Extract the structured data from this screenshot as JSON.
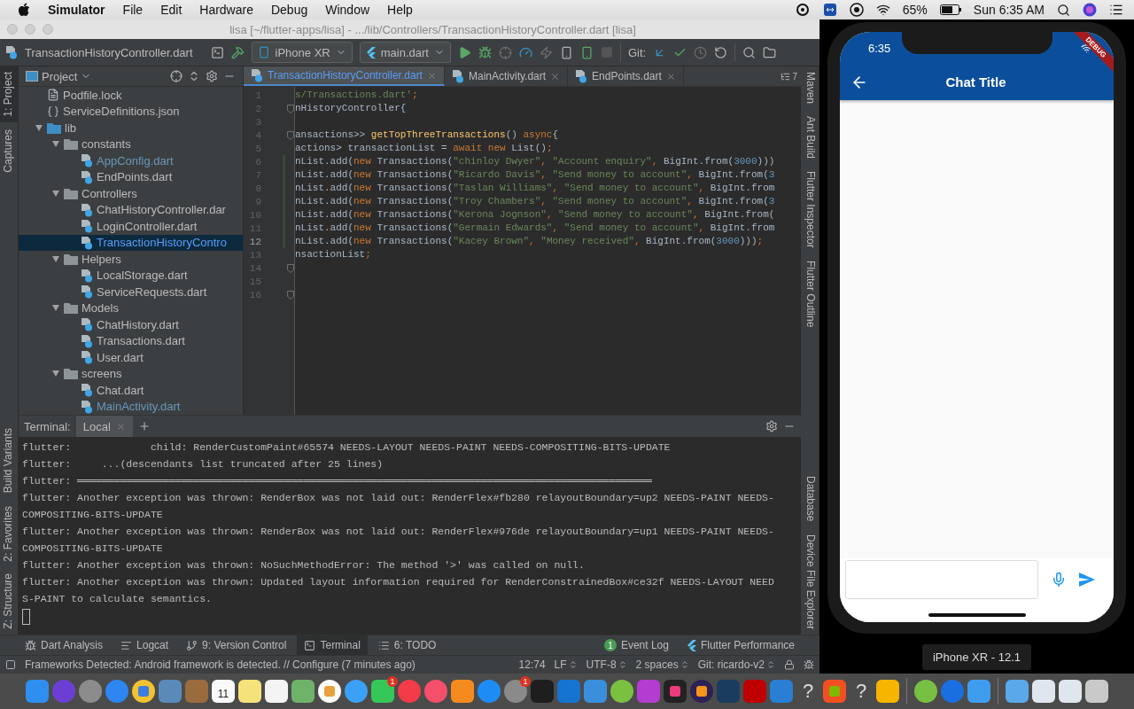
{
  "menu_bar": {
    "app": "Simulator",
    "menus": [
      "File",
      "Edit",
      "Hardware",
      "Debug",
      "Window",
      "Help"
    ],
    "battery": "65%",
    "clock": "Sun 6:35 AM"
  },
  "ide": {
    "title": "lisa [~/flutter-apps/lisa] - .../lib/Controllers/TransactionHistoryController.dart [lisa]",
    "toolbar": {
      "breadcrumb": "TransactionHistoryController.dart",
      "device": "iPhone XR",
      "run_config": "main.dart",
      "git_label": "Git:"
    },
    "left_tools_top": [
      {
        "label": "1: Project",
        "selected": true
      },
      {
        "label": "Captures",
        "selected": false
      }
    ],
    "left_tools_bottom": [
      {
        "label": "Build Variants",
        "selected": false
      },
      {
        "label": "2: Favorites",
        "selected": false
      },
      {
        "label": "Z: Structure",
        "selected": false
      }
    ],
    "right_tools_top": [
      {
        "label": "Maven",
        "selected": false
      },
      {
        "label": "Ant Build",
        "selected": false
      },
      {
        "label": "Flutter Inspector",
        "selected": false
      },
      {
        "label": "Flutter Outline",
        "selected": false
      }
    ],
    "right_tools_bottom": [
      {
        "label": "Database",
        "selected": false
      },
      {
        "label": "Device File Explorer",
        "selected": false
      }
    ],
    "project_panel": {
      "title": "Project",
      "tree": [
        {
          "name": "Podfile.lock",
          "kind": "text",
          "modified": false,
          "selected": false
        },
        {
          "name": "ServiceDefinitions.json",
          "kind": "json",
          "modified": false,
          "selected": false
        },
        {
          "name": "lib",
          "kind": "source",
          "expanded": true,
          "modified": false,
          "selected": false,
          "children": [
            {
              "name": "constants",
              "kind": "folder",
              "expanded": true,
              "modified": false,
              "selected": false,
              "children": [
                {
                  "name": "AppConfig.dart",
                  "kind": "dart",
                  "modified": true,
                  "selected": false
                },
                {
                  "name": "EndPoints.dart",
                  "kind": "dart",
                  "modified": false,
                  "selected": false
                }
              ]
            },
            {
              "name": "Controllers",
              "kind": "folder",
              "expanded": true,
              "modified": false,
              "selected": false,
              "children": [
                {
                  "name": "ChatHistoryController.dar",
                  "kind": "dart",
                  "modified": false,
                  "selected": false
                },
                {
                  "name": "LoginController.dart",
                  "kind": "dart",
                  "modified": false,
                  "selected": false
                },
                {
                  "name": "TransactionHistoryContro",
                  "kind": "dart",
                  "modified": true,
                  "selected": true
                }
              ]
            },
            {
              "name": "Helpers",
              "kind": "folder",
              "expanded": true,
              "modified": false,
              "selected": false,
              "children": [
                {
                  "name": "LocalStorage.dart",
                  "kind": "dart",
                  "modified": false,
                  "selected": false
                },
                {
                  "name": "ServiceRequests.dart",
                  "kind": "dart",
                  "modified": false,
                  "selected": false
                }
              ]
            },
            {
              "name": "Models",
              "kind": "folder",
              "expanded": true,
              "modified": false,
              "selected": false,
              "children": [
                {
                  "name": "ChatHistory.dart",
                  "kind": "dart",
                  "modified": false,
                  "selected": false
                },
                {
                  "name": "Transactions.dart",
                  "kind": "dart",
                  "modified": false,
                  "selected": false
                },
                {
                  "name": "User.dart",
                  "kind": "dart",
                  "modified": false,
                  "selected": false
                }
              ]
            },
            {
              "name": "screens",
              "kind": "folder",
              "expanded": true,
              "modified": false,
              "selected": false,
              "children": [
                {
                  "name": "Chat.dart",
                  "kind": "dart",
                  "modified": false,
                  "selected": false
                },
                {
                  "name": "MainActivity.dart",
                  "kind": "dart",
                  "modified": true,
                  "selected": false
                }
              ]
            }
          ]
        }
      ]
    },
    "editor": {
      "tabs": [
        {
          "label": "TransactionHistoryController.dart",
          "selected": true
        },
        {
          "label": "MainActivity.dart",
          "selected": false
        },
        {
          "label": "EndPoints.dart",
          "selected": false
        }
      ],
      "hidden_tab_count": "7",
      "lines": [
        {
          "number": "1",
          "current": false,
          "changed": false,
          "fold": false,
          "tokens": [
            {
              "kind": "string",
              "text": "s/Transactions.dart'"
            },
            {
              "kind": "keyword",
              "text": ";"
            }
          ]
        },
        {
          "number": "2",
          "current": false,
          "changed": false,
          "fold": true,
          "tokens": [
            {
              "kind": "plain",
              "text": "nHistoryController{"
            }
          ]
        },
        {
          "number": "3",
          "current": false,
          "changed": false,
          "fold": false
        },
        {
          "number": "4",
          "current": false,
          "changed": false,
          "fold": true,
          "tokens": [
            {
              "kind": "plain",
              "text": "ansactions>> "
            },
            {
              "kind": "method",
              "text": "getTopThreeTransactions"
            },
            {
              "kind": "plain",
              "text": "() "
            },
            {
              "kind": "keyword",
              "text": "async"
            },
            {
              "kind": "plain",
              "text": "{"
            }
          ]
        },
        {
          "number": "5",
          "current": false,
          "changed": false,
          "fold": false,
          "tokens": [
            {
              "kind": "plain",
              "text": "actions> transactionList = "
            },
            {
              "kind": "keyword",
              "text": "await new"
            },
            {
              "kind": "plain",
              "text": " List()"
            },
            {
              "kind": "keyword",
              "text": ";"
            }
          ]
        },
        {
          "number": "6",
          "current": false,
          "changed": true,
          "fold": false,
          "tokens": [
            {
              "kind": "plain",
              "text": "nList.add("
            },
            {
              "kind": "keyword",
              "text": "new"
            },
            {
              "kind": "plain",
              "text": " Transactions("
            },
            {
              "kind": "string",
              "text": "\"chinloy Dwyer\""
            },
            {
              "kind": "keyword",
              "text": ","
            },
            {
              "kind": "string",
              "text": " \"Account enquiry\""
            },
            {
              "kind": "keyword",
              "text": ","
            },
            {
              "kind": "plain",
              "text": " BigInt.from("
            },
            {
              "kind": "number",
              "text": "3000"
            },
            {
              "kind": "plain",
              "text": ")))"
            }
          ]
        },
        {
          "number": "7",
          "current": false,
          "changed": true,
          "fold": false,
          "tokens": [
            {
              "kind": "plain",
              "text": "nList.add("
            },
            {
              "kind": "keyword",
              "text": "new"
            },
            {
              "kind": "plain",
              "text": " Transactions("
            },
            {
              "kind": "string",
              "text": "\"Ricardo Davis\""
            },
            {
              "kind": "keyword",
              "text": ","
            },
            {
              "kind": "string",
              "text": " \"Send money to account\""
            },
            {
              "kind": "keyword",
              "text": ","
            },
            {
              "kind": "plain",
              "text": " BigInt.from("
            },
            {
              "kind": "number",
              "text": "3"
            }
          ]
        },
        {
          "number": "8",
          "current": false,
          "changed": true,
          "fold": false,
          "tokens": [
            {
              "kind": "plain",
              "text": "nList.add("
            },
            {
              "kind": "keyword",
              "text": "new"
            },
            {
              "kind": "plain",
              "text": " Transactions("
            },
            {
              "kind": "string",
              "text": "\"Taslan Williams\""
            },
            {
              "kind": "keyword",
              "text": ","
            },
            {
              "kind": "string",
              "text": " \"Send money to account\""
            },
            {
              "kind": "keyword",
              "text": ","
            },
            {
              "kind": "plain",
              "text": " BigInt.from"
            }
          ]
        },
        {
          "number": "9",
          "current": false,
          "changed": true,
          "fold": false,
          "tokens": [
            {
              "kind": "plain",
              "text": "nList.add("
            },
            {
              "kind": "keyword",
              "text": "new"
            },
            {
              "kind": "plain",
              "text": " Transactions("
            },
            {
              "kind": "string",
              "text": "\"Troy Chambers\""
            },
            {
              "kind": "keyword",
              "text": ","
            },
            {
              "kind": "string",
              "text": " \"Send money to account\""
            },
            {
              "kind": "keyword",
              "text": ","
            },
            {
              "kind": "plain",
              "text": " BigInt.from("
            },
            {
              "kind": "number",
              "text": "3"
            }
          ]
        },
        {
          "number": "10",
          "current": false,
          "changed": true,
          "fold": false,
          "tokens": [
            {
              "kind": "plain",
              "text": "nList.add("
            },
            {
              "kind": "keyword",
              "text": "new"
            },
            {
              "kind": "plain",
              "text": " Transactions("
            },
            {
              "kind": "string",
              "text": "\"Kerona Jognson\""
            },
            {
              "kind": "keyword",
              "text": ","
            },
            {
              "kind": "string",
              "text": " \"Send money to account\""
            },
            {
              "kind": "keyword",
              "text": ","
            },
            {
              "kind": "plain",
              "text": " BigInt.from("
            }
          ]
        },
        {
          "number": "11",
          "current": false,
          "changed": true,
          "fold": false,
          "tokens": [
            {
              "kind": "plain",
              "text": "nList.add("
            },
            {
              "kind": "keyword",
              "text": "new"
            },
            {
              "kind": "plain",
              "text": " Transactions("
            },
            {
              "kind": "string",
              "text": "\"Germain Edwards\""
            },
            {
              "kind": "keyword",
              "text": ","
            },
            {
              "kind": "string",
              "text": " \"Send money to account\""
            },
            {
              "kind": "keyword",
              "text": ","
            },
            {
              "kind": "plain",
              "text": " BigInt.from"
            }
          ]
        },
        {
          "number": "12",
          "current": true,
          "changed": true,
          "fold": false,
          "tokens": [
            {
              "kind": "plain",
              "text": "nList.add("
            },
            {
              "kind": "keyword",
              "text": "new"
            },
            {
              "kind": "plain",
              "text": " Transactions("
            },
            {
              "kind": "string",
              "text": "\"Kacey Brown\""
            },
            {
              "kind": "keyword",
              "text": ","
            },
            {
              "kind": "string",
              "text": " \"Money received\""
            },
            {
              "kind": "keyword",
              "text": ","
            },
            {
              "kind": "plain",
              "text": " BigInt.from("
            },
            {
              "kind": "number",
              "text": "3000"
            },
            {
              "kind": "plain",
              "text": ")))"
            },
            {
              "kind": "keyword",
              "text": ";"
            }
          ]
        },
        {
          "number": "13",
          "current": false,
          "changed": false,
          "fold": false,
          "tokens": [
            {
              "kind": "plain",
              "text": "nsactionList"
            },
            {
              "kind": "keyword",
              "text": ";"
            }
          ]
        },
        {
          "number": "14",
          "current": false,
          "changed": false,
          "fold": true
        },
        {
          "number": "15",
          "current": false,
          "changed": false,
          "fold": false
        },
        {
          "number": "16",
          "current": false,
          "changed": false,
          "fold": true
        }
      ]
    },
    "terminal": {
      "title": "Terminal:",
      "tabs": [
        {
          "label": "Local",
          "selected": true
        }
      ],
      "lines": [
        "flutter:             child: RenderCustomPaint#65574 NEEDS-LAYOUT NEEDS-PAINT NEEDS-COMPOSITING-BITS-UPDATE",
        "flutter:     ...(descendants list truncated after 25 lines)",
        "flutter: ══════════════════════════════════════════════════════════════════════════════════════════════",
        "flutter: Another exception was thrown: RenderBox was not laid out: RenderFlex#fb280 relayoutBoundary=up2 NEEDS-PAINT NEEDS-",
        "COMPOSITING-BITS-UPDATE",
        "flutter: Another exception was thrown: RenderBox was not laid out: RenderFlex#976de relayoutBoundary=up1 NEEDS-PAINT NEEDS-",
        "COMPOSITING-BITS-UPDATE",
        "flutter: Another exception was thrown: NoSuchMethodError: The method '>' was called on null.",
        "flutter: Another exception was thrown: Updated layout information required for RenderConstrainedBox#ce32f NEEDS-LAYOUT NEED",
        "S-PAINT to calculate semantics."
      ]
    },
    "bottom_tools_left": [
      {
        "label": "Dart Analysis",
        "kind": "analysis",
        "selected": false
      },
      {
        "label": "Logcat",
        "kind": "log",
        "selected": false
      },
      {
        "label": "9: Version Control",
        "kind": "vcs",
        "selected": false
      },
      {
        "label": "Terminal",
        "kind": "terminal",
        "selected": true
      },
      {
        "label": "6: TODO",
        "kind": "todo",
        "selected": false
      }
    ],
    "bottom_tools_right": [
      {
        "label": "Event Log",
        "badge": "1"
      },
      {
        "label": "Flutter Performance",
        "kind": "flutter"
      }
    ],
    "status_bar": {
      "message": "Frameworks Detected: Android framework is detected. // Configure (7 minutes ago)",
      "position": "12:74",
      "line_separator": "LF",
      "encoding": "UTF-8",
      "indent": "2 spaces",
      "branch": "Git: ricardo-v2"
    }
  },
  "simulator": {
    "time": "6:35",
    "banner": "DEBUG",
    "app_title": "Chat Title",
    "device_label": "iPhone XR - 12.1"
  },
  "dock": {
    "calendar_day": "11",
    "badges": [
      "1",
      "1"
    ],
    "unknown_apps": [
      "?",
      "?"
    ]
  }
}
